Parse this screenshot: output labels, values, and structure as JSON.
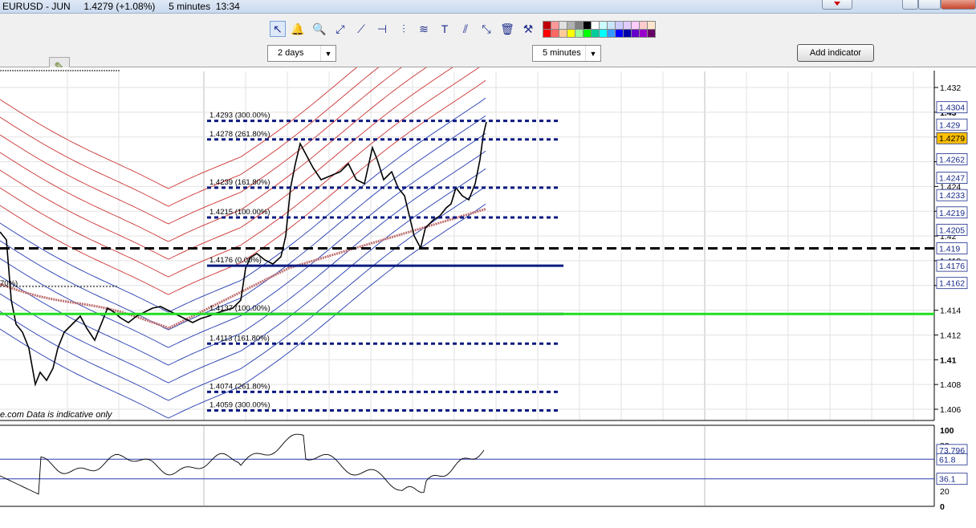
{
  "titlebar": {
    "title": "EURUSD - JUN     1.4279 (+1.08%)     5 minutes  13:34"
  },
  "toolbar": {
    "tools": [
      {
        "name": "select-arrow-icon",
        "glyph": "↖"
      },
      {
        "name": "alarm-bell-icon",
        "glyph": "🔔"
      },
      {
        "name": "zoom-icon",
        "glyph": "🔍"
      },
      {
        "name": "trendline-icon",
        "glyph": "⤢"
      },
      {
        "name": "ray-line-icon",
        "glyph": "⟋"
      },
      {
        "name": "horizontal-line-icon",
        "glyph": "⊣"
      },
      {
        "name": "vertical-line-icon",
        "glyph": "⫶"
      },
      {
        "name": "fibonacci-icon",
        "glyph": "≋"
      },
      {
        "name": "text-tool-icon",
        "glyph": "T"
      },
      {
        "name": "channel-icon",
        "glyph": "⫽"
      },
      {
        "name": "resize-icon",
        "glyph": "⤡"
      },
      {
        "name": "trash-icon",
        "glyph": "🗑"
      },
      {
        "name": "tools-icon",
        "glyph": "⚒"
      }
    ],
    "palette_top": [
      "#c00000",
      "#ff9999",
      "#e0e0e0",
      "#b0b0b0",
      "#808080",
      "#000000",
      "#ffffff",
      "#ccffff",
      "#cce5ff",
      "#ccccff",
      "#e0ccff",
      "#ffccff",
      "#ffcccc",
      "#ffe5cc"
    ],
    "palette_bottom": [
      "#ff0000",
      "#ff6666",
      "#ffcc99",
      "#ffff00",
      "#99ff99",
      "#00ff00",
      "#00cc99",
      "#00ffff",
      "#3399ff",
      "#0000ff",
      "#0000aa",
      "#6600cc",
      "#9900cc",
      "#660066"
    ],
    "period_dropdown": "2 days",
    "interval_dropdown": "5 minutes",
    "add_indicator": "Add indicator"
  },
  "chart": {
    "footer": "e.com  Data is indicative only",
    "price_axis": [
      "1.432",
      "1.43",
      "1.428",
      "1.426",
      "1.424",
      "1.422",
      "1.42",
      "1.418",
      "1.416",
      "1.414",
      "1.412",
      "1.41",
      "1.408",
      "1.406"
    ],
    "price_tags": [
      {
        "text": "1.4304",
        "color": "#1a2a8a",
        "bg": "#ffffff"
      },
      {
        "text": "1.429",
        "color": "#1a2a8a",
        "bg": "#ffffff"
      },
      {
        "text": "1.4279",
        "color": "#000000",
        "bg": "#ffc000"
      },
      {
        "text": "1.4262",
        "color": "#1a2a8a",
        "bg": "#ffffff"
      },
      {
        "text": "1.4247",
        "color": "#1a2a8a",
        "bg": "#ffffff"
      },
      {
        "text": "1.4233",
        "color": "#1a2a8a",
        "bg": "#ffffff"
      },
      {
        "text": "1.4219",
        "color": "#1a2a8a",
        "bg": "#ffffff"
      },
      {
        "text": "1.4205",
        "color": "#1a2a8a",
        "bg": "#ffffff"
      },
      {
        "text": "1.419",
        "color": "#1a2a8a",
        "bg": "#ffffff"
      },
      {
        "text": "1.4176",
        "color": "#1a2a8a",
        "bg": "#ffffff"
      },
      {
        "text": "1.4162",
        "color": "#1a2a8a",
        "bg": "#ffffff"
      }
    ],
    "fib_levels": [
      {
        "label": "1.4293 (300.00%)",
        "price": 1.4293,
        "style": "dotted"
      },
      {
        "label": "1.4278 (261.80%)",
        "price": 1.4278,
        "style": "dotted"
      },
      {
        "label": "1.4239 (161.80%)",
        "price": 1.4239,
        "style": "dotted"
      },
      {
        "label": "1.4215 (100.00%)",
        "price": 1.4215,
        "style": "dotted"
      },
      {
        "label": "1.4176 (0.00%)",
        "price": 1.4176,
        "style": "solid"
      },
      {
        "label": "1.4137 (100.00%)",
        "price": 1.4137,
        "style": "solid"
      },
      {
        "label": "1.4113 (161.80%)",
        "price": 1.4113,
        "style": "dotted"
      },
      {
        "label": "1.4074 (261.80%)",
        "price": 1.4074,
        "style": "dotted"
      },
      {
        "label": "1.4059 (300.00%)",
        "price": 1.4059,
        "style": "dotted"
      }
    ],
    "left_fib_fragment": "70%)",
    "black_dashed_level": 1.419,
    "green_level": 1.4137,
    "oscillator": {
      "axis": [
        "100",
        "80",
        "20",
        "0"
      ],
      "tags": [
        "73.796",
        "61.8",
        "36.1"
      ]
    }
  }
}
